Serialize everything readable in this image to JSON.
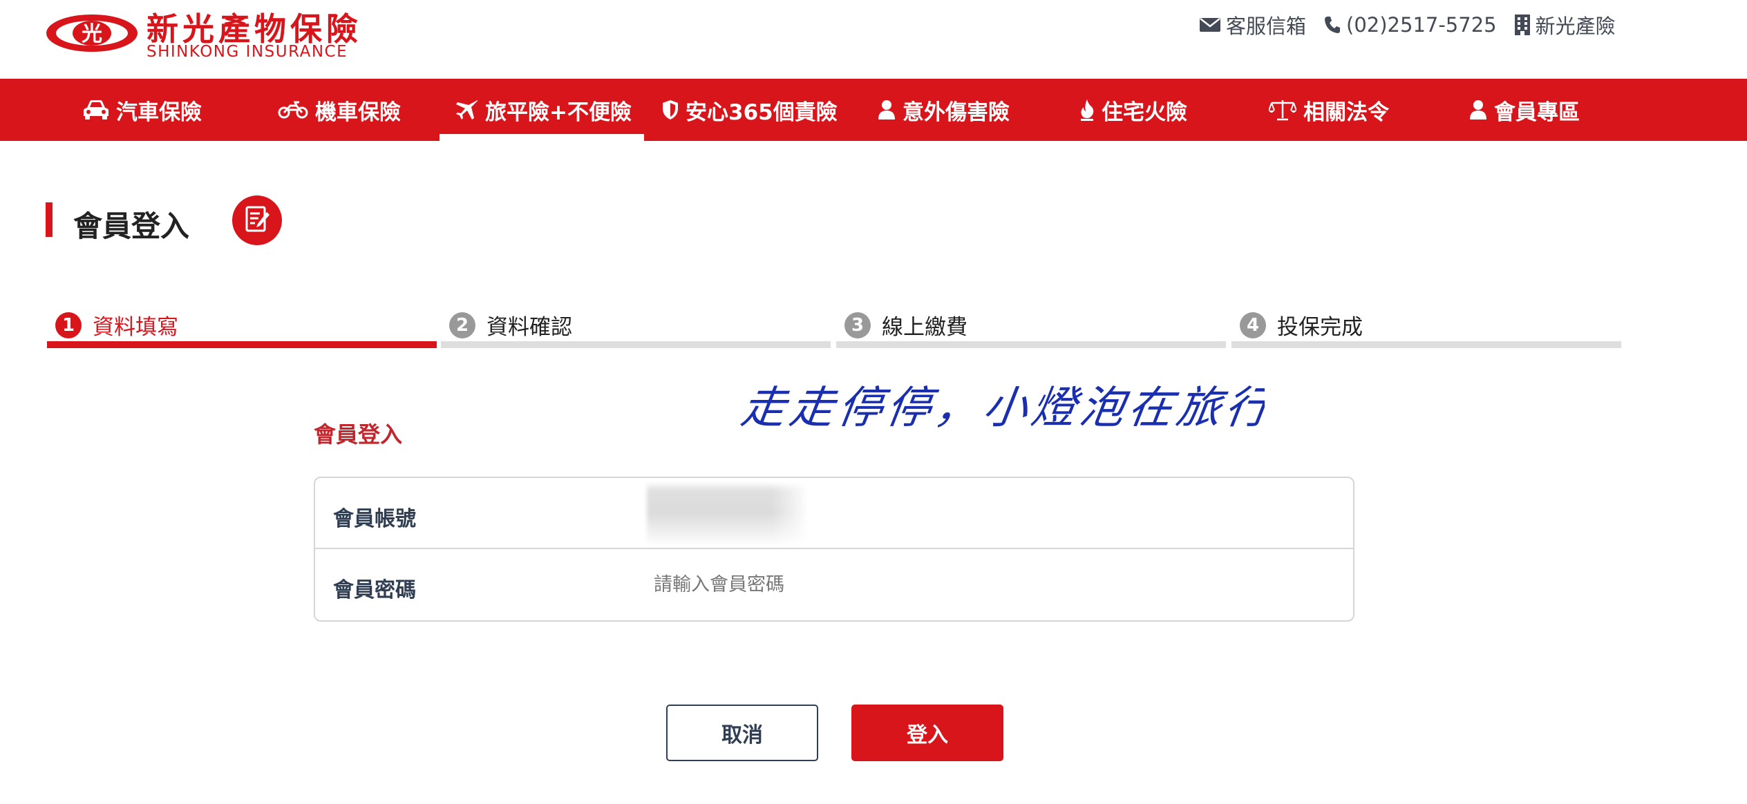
{
  "brand": {
    "emblem_char": "光",
    "name_cn": "新光產物保險",
    "name_en": "SHINKONG INSURANCE",
    "primary_color": "#d9151c",
    "text_navy": "#2f3e52"
  },
  "top_links": [
    {
      "icon": "envelope-icon",
      "label": "客服信箱"
    },
    {
      "icon": "phone-icon",
      "label": "(02)2517-5725"
    },
    {
      "icon": "building-icon",
      "label": "新光產險"
    }
  ],
  "nav": {
    "active_index": 2,
    "items": [
      {
        "icon": "car-icon",
        "label": "汽車保險"
      },
      {
        "icon": "motorcycle-icon",
        "label": "機車保險"
      },
      {
        "icon": "plane-icon",
        "label": "旅平險+不便險"
      },
      {
        "icon": "shield-icon",
        "label": "安心365個責險"
      },
      {
        "icon": "user-icon",
        "label": "意外傷害險"
      },
      {
        "icon": "fire-icon",
        "label": "住宅火險"
      },
      {
        "icon": "scale-icon",
        "label": "相關法令"
      },
      {
        "icon": "user-icon",
        "label": "會員專區"
      }
    ]
  },
  "page": {
    "title": "會員登入",
    "title_icon": "edit-document-icon"
  },
  "steps": {
    "active_index": 0,
    "items": [
      {
        "number": "1",
        "label": "資料填寫"
      },
      {
        "number": "2",
        "label": "資料確認"
      },
      {
        "number": "3",
        "label": "線上繳費"
      },
      {
        "number": "4",
        "label": "投保完成"
      }
    ]
  },
  "signature": {
    "text": "走走停停，小燈泡在旅行",
    "color": "#1a2fb0"
  },
  "form": {
    "title": "會員登入",
    "account": {
      "label": "會員帳號",
      "value": "",
      "placeholder": ""
    },
    "password": {
      "label": "會員密碼",
      "value": "",
      "placeholder": "請輸入會員密碼"
    }
  },
  "buttons": {
    "cancel": "取消",
    "login": "登入"
  }
}
